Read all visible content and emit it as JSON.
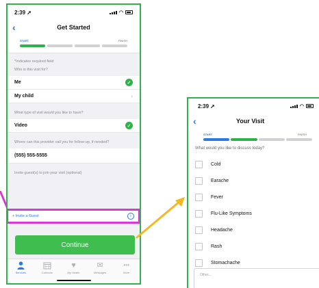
{
  "colors": {
    "green_frame": "#2db34a",
    "highlight": "#d63ad6",
    "arrow": "#f5b820",
    "ios_blue": "#2a7ae2",
    "continue_green": "#3fbe4f"
  },
  "left_screen": {
    "status": {
      "time": "2:39"
    },
    "nav": {
      "title": "Get Started"
    },
    "progress": {
      "start": "START",
      "finish": "FINISH"
    },
    "required_note": "*Indicates required field",
    "who_label": "Who is this visit for?",
    "who_options": [
      {
        "label": "Me",
        "selected": true
      },
      {
        "label": "My child",
        "selected": false
      }
    ],
    "visit_type_label": "What type of visit would you like to have?",
    "visit_type_value": "Video",
    "phone_label": "Where can this provider call you for follow-up, if needed?",
    "phone_value": "(555) 555-5555",
    "invite_label": "Invite guest(s) to join your visit (optional)",
    "invite_link": "+ Invite a Guest",
    "continue_label": "Continue",
    "tabs": [
      {
        "label": "Services",
        "icon": "person-icon",
        "active": true
      },
      {
        "label": "Calendar",
        "icon": "calendar-icon",
        "active": false
      },
      {
        "label": "My Health",
        "icon": "heart-icon",
        "active": false
      },
      {
        "label": "Messages",
        "icon": "mail-icon",
        "active": false
      },
      {
        "label": "More",
        "icon": "more-icon",
        "active": false
      }
    ]
  },
  "right_screen": {
    "status": {
      "time": "2:39"
    },
    "nav": {
      "title": "Your Visit"
    },
    "progress": {
      "start": "START",
      "finish": "FINISH"
    },
    "question": "What would you like to discuss today?",
    "options": [
      "Cold",
      "Earache",
      "Fever",
      "Flu-Like Symptoms",
      "Headache",
      "Rash",
      "Stomachache"
    ],
    "other_placeholder": "Other..."
  }
}
